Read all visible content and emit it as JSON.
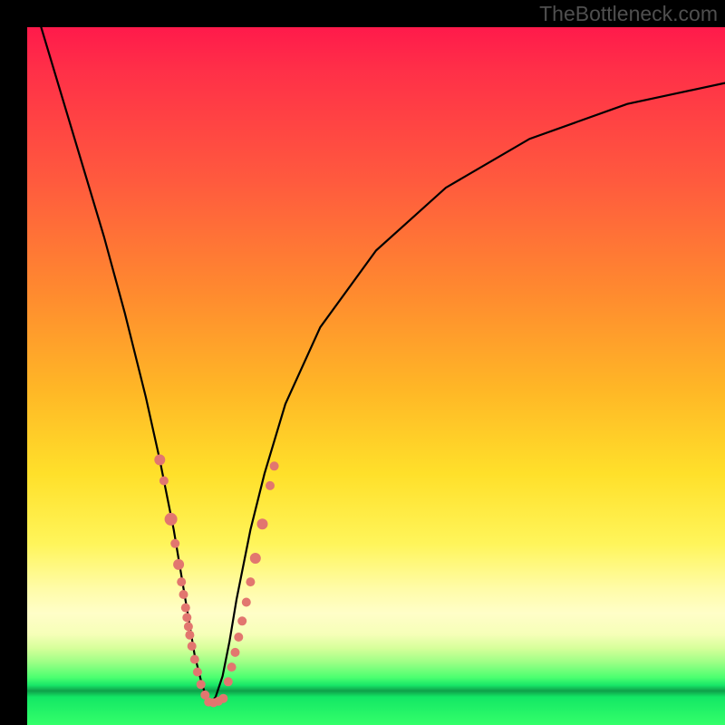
{
  "watermark": "TheBottleneck.com",
  "colors": {
    "frame_bg": "#000000",
    "curve": "#000000",
    "dots": "#e2766f"
  },
  "chart_data": {
    "type": "line",
    "title": "",
    "xlabel": "",
    "ylabel": "",
    "xlim": [
      0,
      100
    ],
    "ylim": [
      0,
      100
    ],
    "grid": false,
    "legend": false,
    "background": "vertical-gradient red→yellow→green",
    "notes": "V-shaped bottleneck curve; minimum ≈ x=26, y≈3. No axis ticks visible.",
    "series": [
      {
        "name": "bottleneck-curve",
        "x": [
          2,
          5,
          8,
          11,
          14,
          17,
          19,
          21,
          22,
          23,
          24,
          25,
          26,
          27,
          28,
          29,
          30,
          32,
          34,
          37,
          42,
          50,
          60,
          72,
          86,
          100
        ],
        "values": [
          100,
          90,
          80,
          70,
          59,
          47,
          38,
          28,
          22,
          16,
          10,
          6,
          3,
          4,
          7,
          12,
          18,
          28,
          36,
          46,
          57,
          68,
          77,
          84,
          89,
          92
        ]
      }
    ],
    "scatter": [
      {
        "name": "left-arm-points",
        "x": [
          19.0,
          19.6,
          20.6,
          21.2,
          21.7,
          22.1,
          22.4,
          22.7,
          22.9,
          23.1,
          23.3,
          23.6,
          24.0,
          24.4,
          24.9,
          25.5
        ],
        "values": [
          38.0,
          35.0,
          29.5,
          26.0,
          23.0,
          20.5,
          18.7,
          16.8,
          15.4,
          14.1,
          12.9,
          11.3,
          9.4,
          7.6,
          5.8,
          4.3
        ],
        "r": [
          6,
          5,
          7,
          5,
          6,
          5,
          5,
          5,
          5,
          5,
          5,
          5,
          5,
          5,
          5,
          5
        ]
      },
      {
        "name": "valley-points",
        "x": [
          26.0,
          26.7,
          27.4,
          28.1
        ],
        "values": [
          3.3,
          3.2,
          3.4,
          3.8
        ],
        "r": [
          5,
          5,
          5,
          5
        ]
      },
      {
        "name": "right-arm-points",
        "x": [
          28.8,
          29.3,
          29.8,
          30.3,
          30.8,
          31.4,
          32.0,
          32.7,
          33.7,
          34.8,
          35.4
        ],
        "values": [
          6.2,
          8.3,
          10.4,
          12.6,
          14.9,
          17.6,
          20.5,
          23.9,
          28.8,
          34.3,
          37.1
        ],
        "r": [
          5,
          5,
          5,
          5,
          5,
          5,
          5,
          6,
          6,
          5,
          5
        ]
      }
    ]
  }
}
